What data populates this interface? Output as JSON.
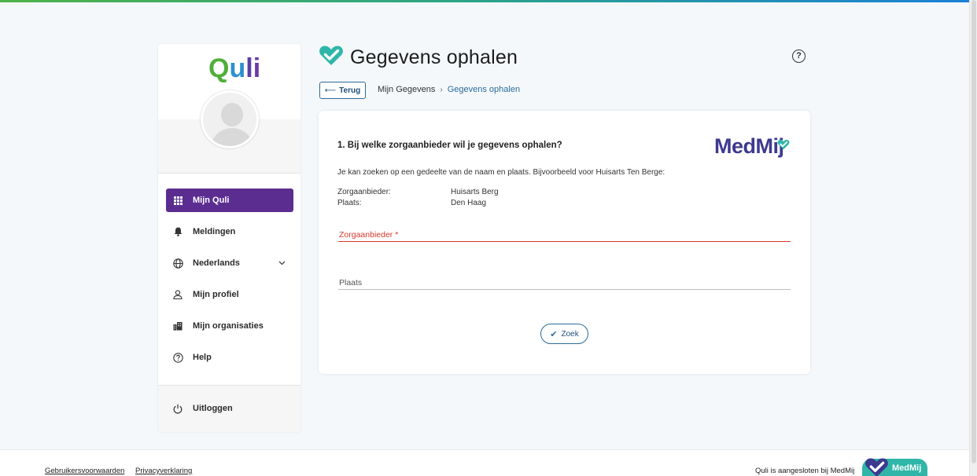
{
  "colors": {
    "accent_purple": "#5b2d91",
    "link_blue": "#2b6b9a",
    "required_red": "#d9362b",
    "check_teal": "#2fb6a8"
  },
  "brand": {
    "logo_q": "Q",
    "logo_u": "u",
    "logo_l": "l",
    "logo_i": "i",
    "logo_full": "Quli"
  },
  "sidebar": {
    "items": [
      {
        "label": "Mijn Quli",
        "icon": "grid-icon",
        "active": true
      },
      {
        "label": "Meldingen",
        "icon": "bell-icon"
      },
      {
        "label": "Nederlands",
        "icon": "globe-icon"
      },
      {
        "label": "Mijn profiel",
        "icon": "user-icon"
      },
      {
        "label": "Mijn organisaties",
        "icon": "buildings-icon"
      },
      {
        "label": "Help",
        "icon": "help-circle-icon"
      }
    ],
    "logout": {
      "label": "Uitloggen",
      "icon": "power-icon"
    }
  },
  "header": {
    "title": "Gegevens ophalen",
    "back_label": "Terug",
    "back_arrow": "⟵",
    "help_glyph": "?"
  },
  "breadcrumb": {
    "parent": "Mijn Gegevens",
    "separator": "›",
    "current": "Gegevens ophalen"
  },
  "form": {
    "question": "1. Bij welke zorgaanbieder wil je gegevens ophalen?",
    "description": "Je kan zoeken op een gedeelte van de naam en plaats. Bijvoorbeeld voor Huisarts Ten Berge:",
    "example": [
      {
        "key": "Zorgaanbieder:",
        "value": "Huisarts Berg"
      },
      {
        "key": "Plaats:",
        "value": "Den Haag"
      }
    ],
    "provider_label": "Zorgaanbieder *",
    "place_label": "Plaats",
    "search_label": "Zoek",
    "search_check": "✔",
    "medmij_logo": "MedMij"
  },
  "footer": {
    "terms": "Gebruikersvoorwaarden",
    "privacy": "Privacyverklaring",
    "note": "Quli is aangesloten bij MedMij",
    "badge_text": "MedMij"
  }
}
